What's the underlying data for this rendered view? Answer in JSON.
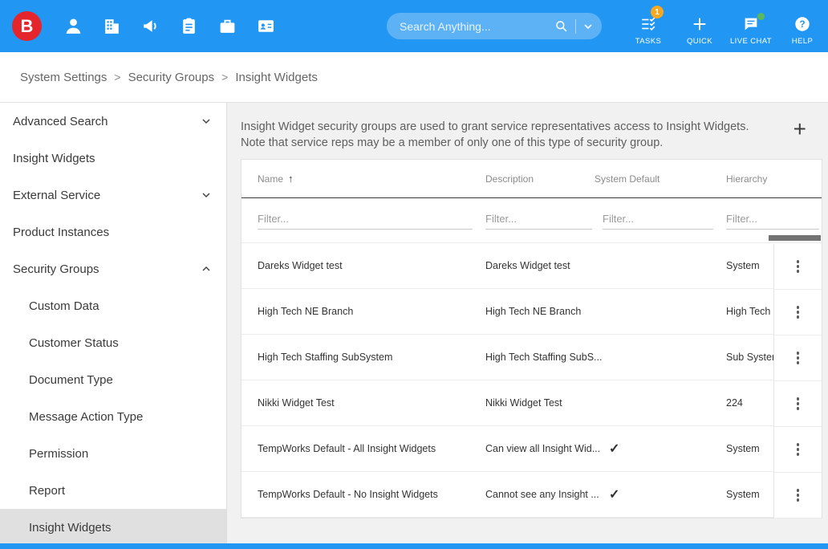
{
  "colors": {
    "header_blue": "#2196f3",
    "logo_red": "#e5252c",
    "badge_orange": "#f6a821",
    "chat_green": "#5cb85c",
    "selected_gray": "#e0e0e0"
  },
  "header": {
    "logo_letter": "B",
    "nav_icons": [
      {
        "name": "employee-icon"
      },
      {
        "name": "company-icon"
      },
      {
        "name": "megaphone-icon"
      },
      {
        "name": "clipboard-icon"
      },
      {
        "name": "briefcase-icon"
      },
      {
        "name": "contact-card-icon"
      }
    ],
    "search_placeholder": "Search Anything...",
    "actions": [
      {
        "label": "TASKS",
        "icon": "tasks-icon",
        "badge": "1"
      },
      {
        "label": "QUICK",
        "icon": "plus-icon"
      },
      {
        "label": "LIVE CHAT",
        "icon": "chat-icon",
        "dot": true
      },
      {
        "label": "HELP",
        "icon": "help-icon"
      }
    ]
  },
  "breadcrumb": [
    "System Settings",
    "Security Groups",
    "Insight Widgets"
  ],
  "sidebar": [
    {
      "label": "Advanced Search",
      "chevron": "down"
    },
    {
      "label": "Insight Widgets"
    },
    {
      "label": "External Service",
      "chevron": "down"
    },
    {
      "label": "Product Instances"
    },
    {
      "label": "Security Groups",
      "chevron": "up"
    },
    {
      "label": "Custom Data",
      "sub": true
    },
    {
      "label": "Customer Status",
      "sub": true
    },
    {
      "label": "Document Type",
      "sub": true
    },
    {
      "label": "Message Action Type",
      "sub": true
    },
    {
      "label": "Permission",
      "sub": true
    },
    {
      "label": "Report",
      "sub": true
    },
    {
      "label": "Insight Widgets",
      "sub": true,
      "selected": true
    }
  ],
  "main": {
    "description": "Insight Widget security groups are used to grant service representatives access to Insight Widgets. Note that service reps may be a member of only one of this type of security group.",
    "add_label": "+",
    "table": {
      "columns": [
        {
          "label": "Name",
          "sorted": "asc"
        },
        {
          "label": "Description"
        },
        {
          "label": "System Default"
        },
        {
          "label": "Hierarchy"
        }
      ],
      "filter_placeholder": "Filter...",
      "check_glyph": "✓",
      "rows": [
        {
          "name": "Dareks Widget test",
          "description": "Dareks Widget test",
          "system_default": false,
          "hierarchy": "System"
        },
        {
          "name": "High Tech NE Branch",
          "description": "High Tech NE Branch",
          "system_default": false,
          "hierarchy": "High Tech NE Branch"
        },
        {
          "name": "High Tech Staffing SubSystem",
          "description": "High Tech Staffing SubS...",
          "system_default": false,
          "hierarchy": "Sub System"
        },
        {
          "name": "Nikki Widget Test",
          "description": "Nikki Widget Test",
          "system_default": false,
          "hierarchy": "224"
        },
        {
          "name": "TempWorks Default - All Insight Widgets",
          "description": "Can view all Insight Wid...",
          "system_default": true,
          "hierarchy": "System"
        },
        {
          "name": "TempWorks Default - No Insight Widgets",
          "description": "Cannot see any Insight ...",
          "system_default": true,
          "hierarchy": "System"
        }
      ]
    }
  }
}
